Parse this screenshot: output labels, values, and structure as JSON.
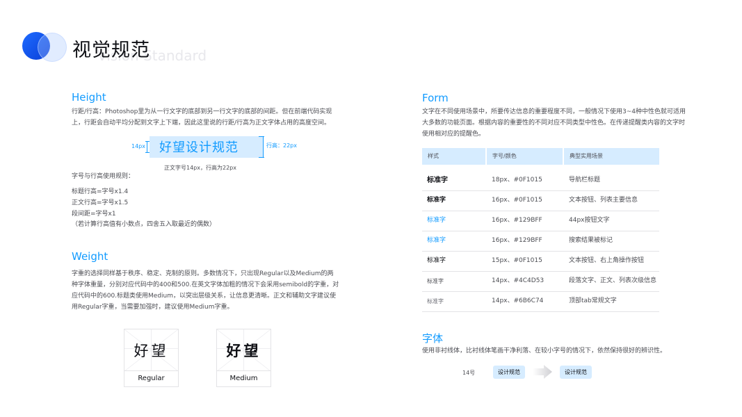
{
  "header": {
    "title": "视觉规范",
    "subtitle": "Vision Standard"
  },
  "height": {
    "title": "Height",
    "desc": "行距/行高：Photoshop里为从一行文字的底部到另一行文字的底部的间距。但在前端代码实现上，行距会自动平均分配到文字上下端，因此这里说的行距/行高为正文字体占用的高度空间。",
    "demo_text": "好望设计规范",
    "label_14": "14px",
    "label_line": "行高：22px",
    "caption": "正文字号14px，行高为22px",
    "rules_title": "字号与行高使用规则：",
    "rules": [
      "标题行高=字号x1.4",
      "正文行高=字号x1.5",
      "段间距=字号x1",
      "（若计算行高值有小数点，四舍五入取最近的偶数）"
    ]
  },
  "weight": {
    "title": "Weight",
    "desc": "字重的选择同样基于秩序、稳定、克制的原则。多数情况下，只出现Regular以及Medium的两种字体重量，分别对应代码中的400和500.在英文字体加粗的情况下会采用semibold的字重，对应代码中的600.标题类使用Medium，以突出层级关系，让信息更清晰。正文和辅助文字建议使用Regular字重，当需要加强时，建议使用Medium字重。",
    "cards": [
      {
        "glyph": "好望",
        "label": "Regular"
      },
      {
        "glyph": "好望",
        "label": "Medium"
      }
    ]
  },
  "form": {
    "title": "Form",
    "desc": "文字在不同使用场景中，所要传达信息的重要程度不同，一般情况下使用3~4种中性色就可适用大多数的功能页面。根据内容的重要性的不同对应不同类型中性色。在传递提醒类内容的文字时使用相对应的提醒色。",
    "headers": [
      "样式",
      "字号/颜色",
      "典型实用场景"
    ],
    "rows": [
      {
        "style": "标准字",
        "spec": "18px、#0F1015",
        "usage": "导航栏标题",
        "color": "#0F1015"
      },
      {
        "style": "标准字",
        "spec": "16px、#0F1015",
        "usage": "文本按钮、列表主要信息",
        "color": "#0F1015"
      },
      {
        "style": "标准字",
        "spec": "16px、#129BFF",
        "usage": "44px按钮文字",
        "color": "#129BFF"
      },
      {
        "style": "标准字",
        "spec": "16px、#129BFF",
        "usage": "搜索结果被标记",
        "color": "#129BFF"
      },
      {
        "style": "标准字",
        "spec": "15px、#0F1015",
        "usage": "文本按钮、右上角操作按钮",
        "color": "#0F1015"
      },
      {
        "style": "标准字",
        "spec": "14px、#4C4D53",
        "usage": "段落文字、正文、列表次级信息",
        "color": "#4C4D53"
      },
      {
        "style": "标准字",
        "spec": "14px、#6B6C74",
        "usage": "顶部tab常规文字",
        "color": "#6B6C74"
      }
    ]
  },
  "font": {
    "title": "字体",
    "desc": "使用非衬线体，比衬线体笔画干净利落、在较小字号的情况下，依然保持很好的辨识性。",
    "size_label": "14号",
    "serif_sample": "设计规范",
    "sans_sample": "设计规范"
  },
  "colors": {
    "accent": "#129BFF",
    "title": "#0F1015",
    "body": "#4C4D53",
    "light_blue": "#D6ECFF"
  }
}
